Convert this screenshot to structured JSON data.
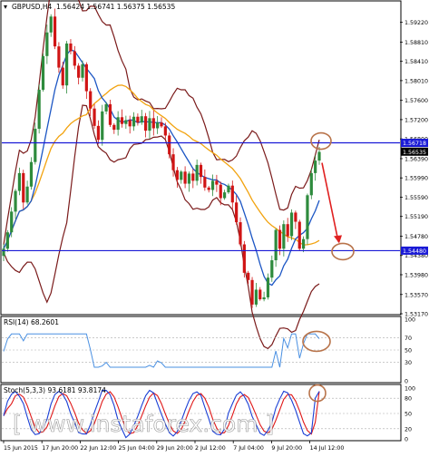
{
  "header": {
    "symbol_timeframe": "GBPUSD,H4",
    "ohlc": "1.56424 1.56741 1.56375 1.56535"
  },
  "colors": {
    "bull_candle": "#2e8b3d",
    "bear_candle": "#d01515",
    "bollinger": "#7a1a1a",
    "ma_fast": "#1c56c4",
    "ma_slow": "#f2a30f",
    "level_line": "#1a1ad6",
    "rsi_line": "#4a90e2",
    "stoch_main": "#1a3fd6",
    "stoch_signal": "#e01818",
    "circle": "#b8734a",
    "arrow": "#e02020",
    "price_box": "#1a1ad6",
    "current_price_box": "#000000"
  },
  "main_panel": {
    "y_ticks": [
      "1.59220",
      "1.58810",
      "1.58410",
      "1.58010",
      "1.57600",
      "1.57200",
      "1.56800",
      "1.56390",
      "1.55990",
      "1.55590",
      "1.55190",
      "1.54780",
      "1.54380",
      "1.53980",
      "1.53570",
      "1.53170"
    ],
    "level_high": "1.56718",
    "level_low": "1.54480",
    "current_price": "1.56535",
    "x_labels": [
      "15 Jun 2015",
      "17 Jun 20:00",
      "22 Jun 12:00",
      "25 Jun 04:00",
      "29 Jun 20:00",
      "2 Jul 12:00",
      "7 Jul 04:00",
      "9 Jul 20:00",
      "14 Jul 12:00"
    ]
  },
  "rsi_panel": {
    "label": "RSI(14) 68.2601",
    "y_ticks": [
      "100",
      "70",
      "50",
      "30",
      "0"
    ]
  },
  "stoch_panel": {
    "label": "Stoch(5,3,3) 93.6181 93.8174",
    "y_ticks": [
      "100",
      "80",
      "50",
      "20",
      "0"
    ]
  },
  "watermark": "[ www.instaforex.com ]",
  "chart_data": {
    "type": "candlestick",
    "instrument": "GBPUSD",
    "timeframe": "H4",
    "ylim": [
      1.5317,
      1.5942
    ],
    "horizontal_levels": [
      1.56718,
      1.5448
    ],
    "close_series": [
      1.5452,
      1.5486,
      1.5529,
      1.5572,
      1.5609,
      1.5548,
      1.5581,
      1.5632,
      1.5701,
      1.5782,
      1.5852,
      1.5901,
      1.5934,
      1.5872,
      1.5828,
      1.5791,
      1.5878,
      1.5862,
      1.5832,
      1.5807,
      1.5835,
      1.5779,
      1.5743,
      1.5707,
      1.5678,
      1.5737,
      1.5752,
      1.5709,
      1.5699,
      1.5725,
      1.5711,
      1.5719,
      1.5706,
      1.5726,
      1.5714,
      1.5727,
      1.5697,
      1.5723,
      1.5702,
      1.5714,
      1.5706,
      1.5687,
      1.5648,
      1.5615,
      1.5595,
      1.5612,
      1.5587,
      1.5608,
      1.5593,
      1.5626,
      1.5601,
      1.5579,
      1.5574,
      1.5593,
      1.5585,
      1.5557,
      1.5569,
      1.5583,
      1.5548,
      1.5507,
      1.5461,
      1.5402,
      1.5387,
      1.5336,
      1.5367,
      1.5347,
      1.5351,
      1.5392,
      1.5428,
      1.5491,
      1.5452,
      1.5503,
      1.5478,
      1.5527,
      1.5508,
      1.5452,
      1.5472,
      1.5563,
      1.5609,
      1.5635,
      1.5653
    ],
    "rsi": {
      "period": 14,
      "value": 68.2601,
      "levels": [
        70,
        50,
        30
      ]
    },
    "stochastic": {
      "params": [
        5,
        3,
        3
      ],
      "main": 93.6181,
      "signal": 93.8174,
      "levels": [
        80,
        50,
        20
      ]
    },
    "annotations": [
      "projected decline from 1.56718 resistance toward 1.54480 support",
      "overbought circles on RSI and Stochastic"
    ]
  }
}
